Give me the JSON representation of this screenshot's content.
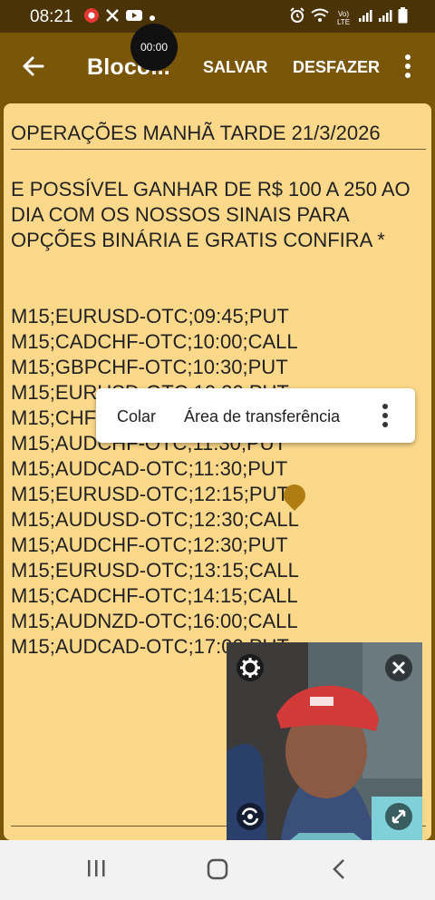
{
  "status_bar": {
    "time": "08:21",
    "lte_label": "Vo) LTE"
  },
  "appbar": {
    "title": "Bloco...",
    "save_label": "SALVAR",
    "undo_label": "DESFAZER"
  },
  "recording_timer": "00:00",
  "note": {
    "title": "OPERAÇÕES MANHÃ TARDE 21/3/2026",
    "intro_lines": [
      "E POSSÍVEL GANHAR DE R$ 100 A 250 AO",
      "DIA COM OS NOSSOS SINAIS PARA",
      "OPÇÕES BINÁRIA E GRATIS CONFIRA *"
    ],
    "signals": [
      "M15;EURUSD-OTC;09:45;PUT",
      "M15;CADCHF-OTC;10:00;CALL",
      "M15;GBPCHF-OTC;10:30;PUT",
      "M15;EURUSD-OTC;10:30;PUT",
      "M15;CHFJPY-OTC;11:00;CALL",
      "M15;AUDCHF-OTC;11:30;PUT",
      "M15;AUDCAD-OTC;11:30;PUT",
      "M15;EURUSD-OTC;12:15;PUT",
      "M15;AUDUSD-OTC;12:30;CALL",
      "M15;AUDCHF-OTC;12:30;PUT",
      "M15;EURUSD-OTC;13:15;CALL",
      "M15;CADCHF-OTC;14:15;CALL",
      "M15;AUDNZD-OTC;16:00;CALL",
      "M15;AUDCAD-OTC;17:00;PUT"
    ]
  },
  "context_menu": {
    "paste_label": "Colar",
    "clipboard_label": "Área de transferência"
  },
  "colors": {
    "status_bar": "#4a3306",
    "appbar": "#7a5608",
    "note_paper": "#fcd98a"
  },
  "icons": [
    "back-arrow-icon",
    "more-vert-icon",
    "settings-gear-icon",
    "close-icon",
    "camera-rotate-icon",
    "expand-icon",
    "recent-apps-icon",
    "home-icon",
    "back-nav-icon"
  ]
}
